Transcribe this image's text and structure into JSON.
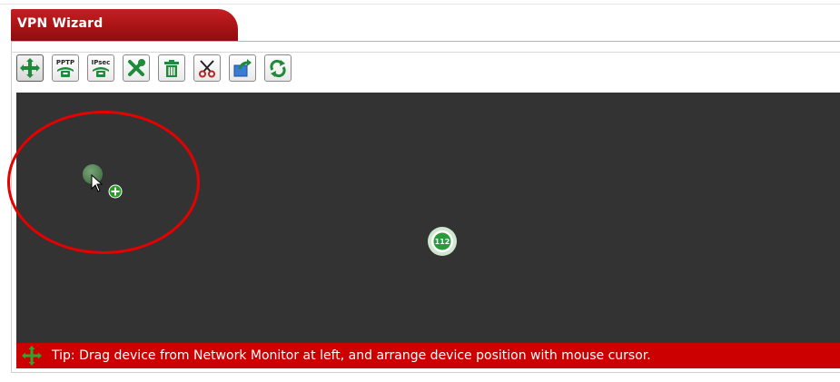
{
  "window": {
    "title": "VPN Wizard"
  },
  "toolbar": {
    "buttons": [
      {
        "name": "add-device",
        "icon": "move-plus-icon",
        "active": true
      },
      {
        "name": "pptp-connection",
        "icon": "pptp-icon",
        "label": "PPTP"
      },
      {
        "name": "ipsec-connection",
        "icon": "ipsec-icon",
        "label": "IPsec"
      },
      {
        "name": "settings",
        "icon": "tools-icon"
      },
      {
        "name": "delete",
        "icon": "trash-icon"
      },
      {
        "name": "cut",
        "icon": "scissors-icon"
      },
      {
        "name": "export",
        "icon": "export-icon"
      },
      {
        "name": "refresh",
        "icon": "refresh-icon"
      }
    ]
  },
  "canvas": {
    "background": "#333333",
    "nodes": [
      {
        "name": "dragging-device",
        "icon": "device-dot-icon"
      },
      {
        "name": "router-device",
        "icon": "router-icon",
        "label": "112"
      }
    ]
  },
  "tip": {
    "text": "Tip: Drag device from Network Monitor at left, and arrange device position with mouse cursor.",
    "icon": "move-icon"
  },
  "colors": {
    "accent": "#cc0000",
    "tab": "#b31417",
    "icon_green": "#1f8a3a",
    "annotation": "#e60000"
  }
}
